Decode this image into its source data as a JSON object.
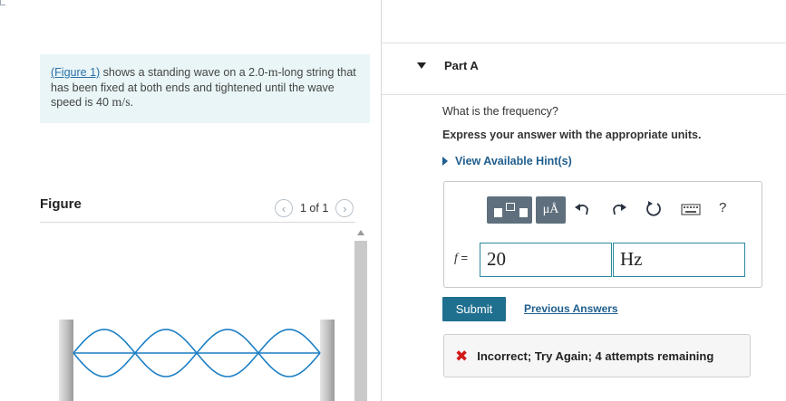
{
  "intro": {
    "figure_link": "(Figure 1)",
    "text_part1": " shows a standing wave on a 2.0-",
    "unit_m": "m",
    "text_part2": "-long string that has been fixed at both ends and tightened until the wave speed is 40 ",
    "unit_speed": "m/s",
    "text_end": "."
  },
  "figure": {
    "title": "Figure",
    "pager": "1 of 1",
    "prev_icon": "chevron-left-icon",
    "next_icon": "chevron-right-icon",
    "antinodes": 4
  },
  "part": {
    "title": "Part A",
    "question": "What is the frequency?",
    "instruction": "Express your answer with the appropriate units.",
    "hint": "View Available Hint(s)"
  },
  "toolbar": {
    "units_button_label": "μÅ",
    "help_label": "?",
    "icons": [
      "templates-icon",
      "units-icon",
      "undo-icon",
      "redo-icon",
      "reset-icon",
      "keyboard-icon",
      "help-icon"
    ]
  },
  "answer": {
    "variable": "f",
    "equals": " =",
    "value": "20",
    "unit": "Hz"
  },
  "actions": {
    "submit": "Submit",
    "previous_answers": "Previous Answers"
  },
  "feedback": {
    "message": "Incorrect; Try Again; 4 attempts remaining"
  },
  "colors": {
    "intro_bg": "#e9f5f6",
    "accent": "#1f6f8f",
    "link": "#1f5e8d",
    "error": "#d11a1a",
    "wave": "#1c7fc4"
  }
}
